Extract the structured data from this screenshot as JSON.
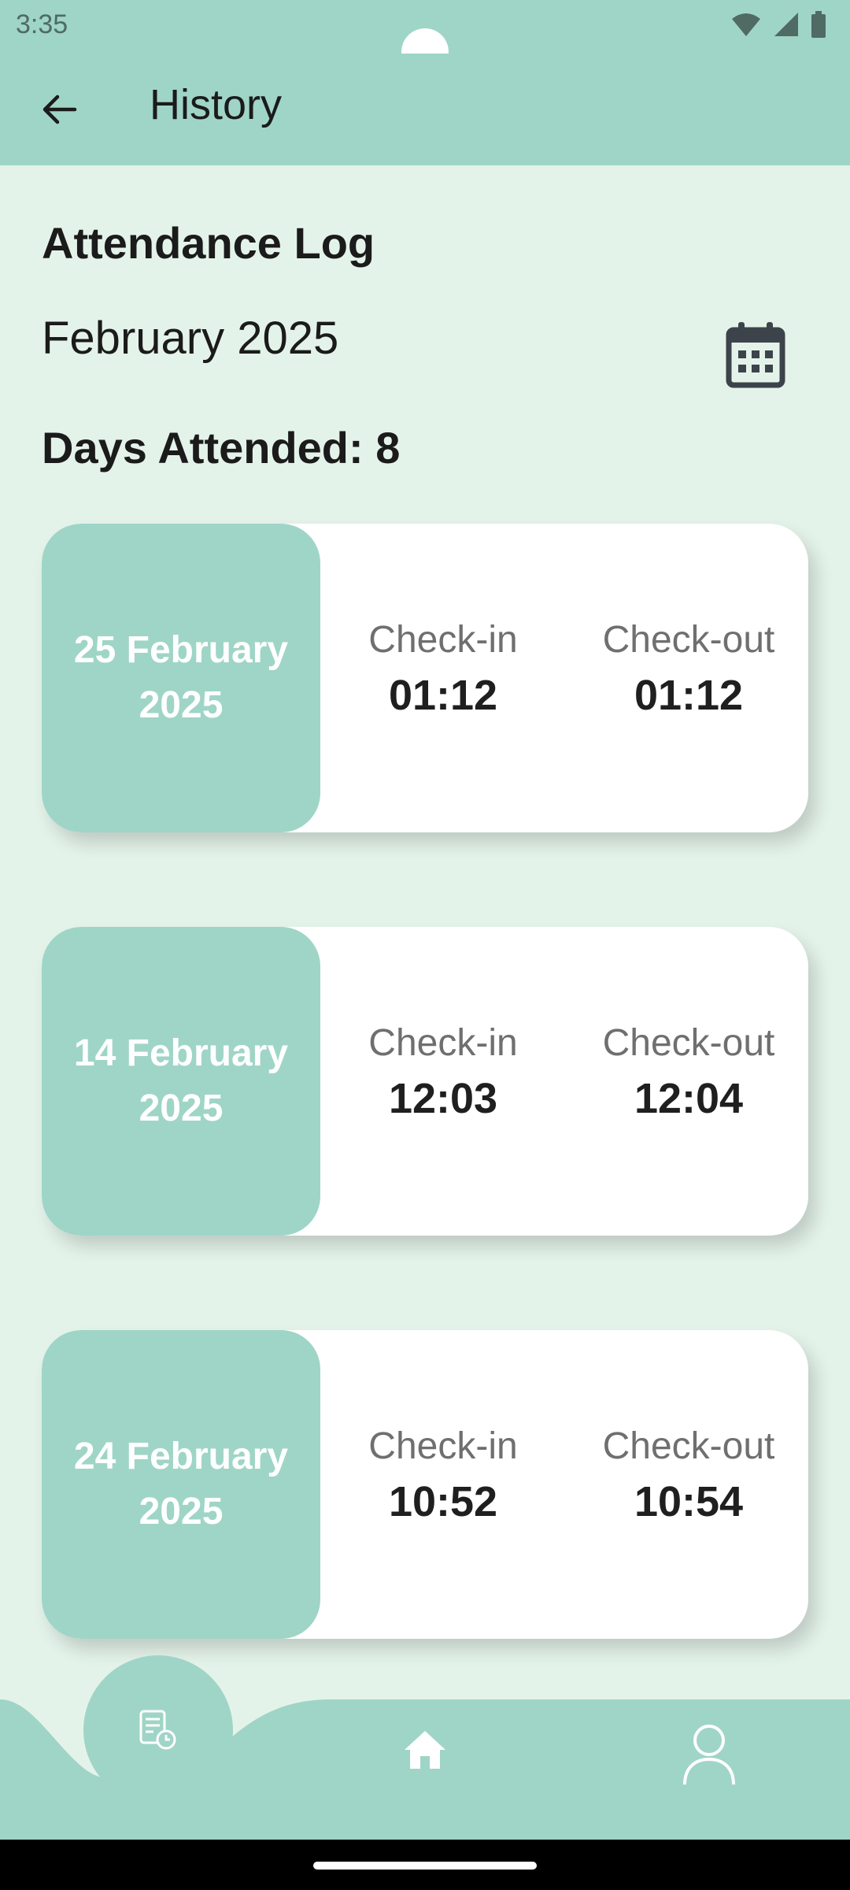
{
  "status_bar": {
    "time": "3:35"
  },
  "app_bar": {
    "title": "History"
  },
  "header": {
    "section_title": "Attendance Log",
    "month": "February 2025",
    "days_attended": "Days Attended: 8"
  },
  "labels": {
    "check_in": "Check-in",
    "check_out": "Check-out"
  },
  "records": [
    {
      "date_line1": "25 February",
      "date_line2": "2025",
      "check_in": "01:12",
      "check_out": "01:12"
    },
    {
      "date_line1": "14 February",
      "date_line2": "2025",
      "check_in": "12:03",
      "check_out": "12:04"
    },
    {
      "date_line1": "24 February",
      "date_line2": "2025",
      "check_in": "10:52",
      "check_out": "10:54"
    }
  ],
  "icons": {
    "back": "arrow-left-icon",
    "calendar": "calendar-icon",
    "history": "history-log-icon",
    "home": "home-icon",
    "profile": "person-icon"
  },
  "colors": {
    "accent": "#9FD5C6",
    "background": "#E4F3EA",
    "card": "#FFFFFF"
  }
}
